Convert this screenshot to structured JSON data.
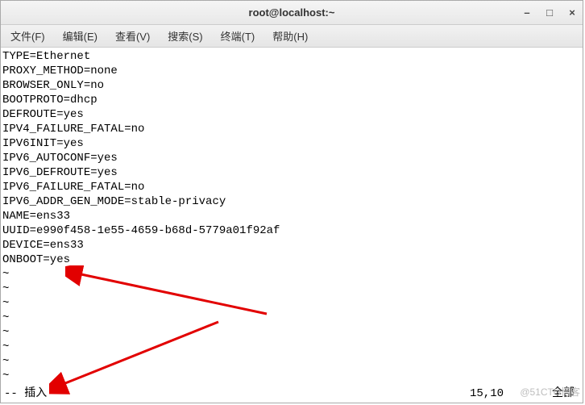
{
  "window": {
    "title": "root@localhost:~"
  },
  "menu": {
    "file": "文件(F)",
    "edit": "编辑(E)",
    "view": "查看(V)",
    "search": "搜索(S)",
    "terminal": "终端(T)",
    "help": "帮助(H)"
  },
  "content": {
    "lines": [
      "TYPE=Ethernet",
      "PROXY_METHOD=none",
      "BROWSER_ONLY=no",
      "BOOTPROTO=dhcp",
      "DEFROUTE=yes",
      "IPV4_FAILURE_FATAL=no",
      "IPV6INIT=yes",
      "IPV6_AUTOCONF=yes",
      "IPV6_DEFROUTE=yes",
      "IPV6_FAILURE_FATAL=no",
      "IPV6_ADDR_GEN_MODE=stable-privacy",
      "NAME=ens33",
      "UUID=e990f458-1e55-4659-b68d-5779a01f92af",
      "DEVICE=ens33",
      "ONBOOT=yes"
    ]
  },
  "status": {
    "mode": "-- 插入 --",
    "position": "15,10",
    "scroll": "全部"
  },
  "watermark": "@51CTO博客"
}
